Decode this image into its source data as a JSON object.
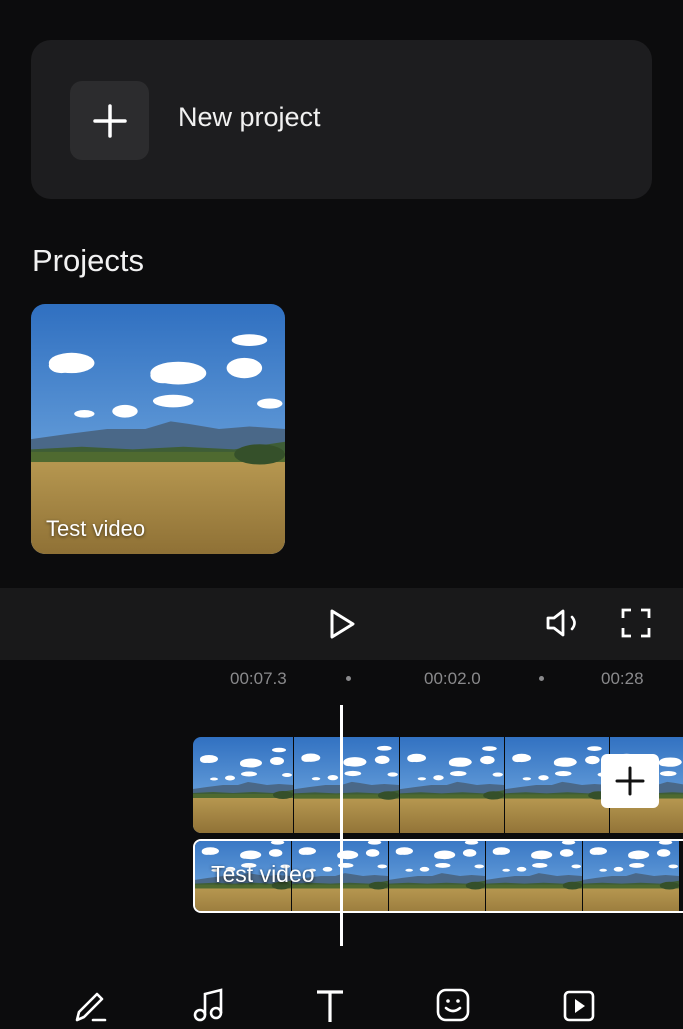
{
  "new_project": {
    "label": "New project"
  },
  "projects": {
    "title": "Projects",
    "items": [
      {
        "name": "Test video"
      }
    ]
  },
  "timeline": {
    "times": [
      "00:07.3",
      "00:02.0",
      "00:28"
    ],
    "track_label": "Test video"
  },
  "toolbar": {
    "icons": [
      "edit-icon",
      "music-icon",
      "text-icon",
      "sticker-icon",
      "media-icon"
    ]
  },
  "colors": {
    "background": "#0c0c0d",
    "card": "#1d1d1f",
    "accent": "#ffffff"
  }
}
